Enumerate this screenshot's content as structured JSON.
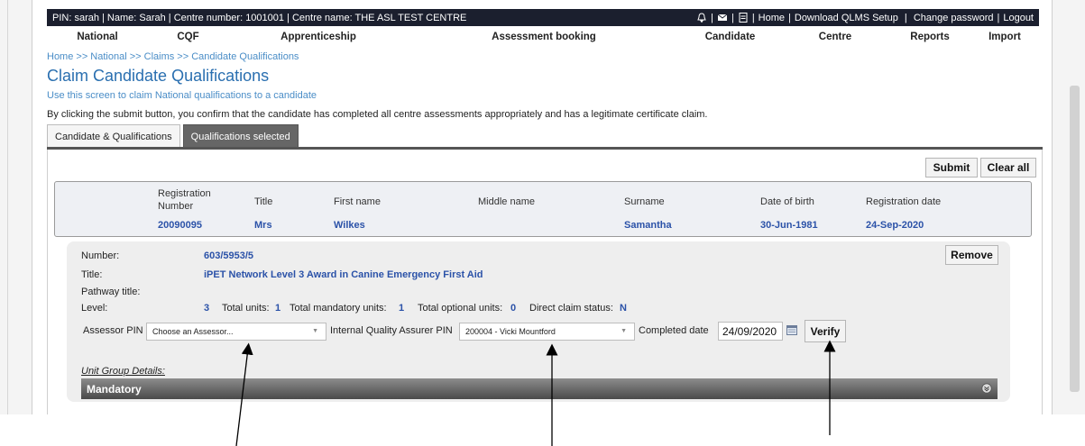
{
  "topbar": {
    "user_info": "PIN: sarah | Name: Sarah | Centre number: 1001001 | Centre name: THE ASL TEST CENTRE",
    "links": [
      "Home",
      "Download QLMS Setup",
      "Change password",
      "Logout"
    ],
    "icons": [
      "bell-icon",
      "mail-icon",
      "document-icon"
    ]
  },
  "nav": {
    "items": [
      "National",
      "CQF",
      "Apprenticeship",
      "Assessment booking",
      "Candidate",
      "Centre",
      "Reports",
      "Import"
    ]
  },
  "breadcrumb": "Home >> National >> Claims >> Candidate Qualifications",
  "page": {
    "title": "Claim Candidate Qualifications",
    "subtitle": "Use this screen to claim National qualifications to a candidate",
    "confirm_text": "By clicking the submit button, you confirm that the candidate has completed all centre assessments appropriately and has a legitimate certificate claim."
  },
  "tabs": [
    {
      "label": "Candidate & Qualifications",
      "active": false
    },
    {
      "label": "Qualifications selected",
      "active": true
    }
  ],
  "actions": {
    "submit": "Submit",
    "clear_all": "Clear all"
  },
  "candidate": {
    "headers": {
      "registration_number": "Registration Number",
      "title": "Title",
      "first_name": "First name",
      "middle_name": "Middle name",
      "surname": "Surname",
      "dob": "Date of birth",
      "registration_date": "Registration date"
    },
    "values": {
      "registration_number": "20090095",
      "title": "Mrs",
      "first_name": "Wilkes",
      "middle_name": "",
      "surname": "Samantha",
      "dob": "30-Jun-1981",
      "registration_date": "24-Sep-2020"
    }
  },
  "qualification": {
    "labels": {
      "number": "Number:",
      "title": "Title:",
      "pathway": "Pathway title:",
      "level": "Level:",
      "total_units": "Total units:",
      "mandatory_units": "Total mandatory units:",
      "optional_units": "Total optional units:",
      "direct_claim": "Direct claim status:"
    },
    "number": "603/5953/5",
    "title": "iPET Network Level 3 Award in Canine Emergency First Aid",
    "pathway": "",
    "level": "3",
    "total_units": "1",
    "mandatory_units": "1",
    "optional_units": "0",
    "direct_claim": "N",
    "remove_label": "Remove"
  },
  "claim_form": {
    "assessor_label": "Assessor PIN",
    "assessor_value": "Choose an Assessor...",
    "iqa_label": "Internal Quality Assurer PIN",
    "iqa_value": "200004 - Vicki Mountford",
    "completed_label": "Completed date",
    "completed_value": "24/09/2020",
    "verify_label": "Verify"
  },
  "unit_group": {
    "heading": "Unit Group Details:",
    "mandatory_label": "Mandatory"
  },
  "colors": {
    "topbar_bg": "#1b1f2e",
    "link_blue": "#4a8dc7",
    "value_blue": "#2b52a8",
    "tab_active": "#666666"
  }
}
